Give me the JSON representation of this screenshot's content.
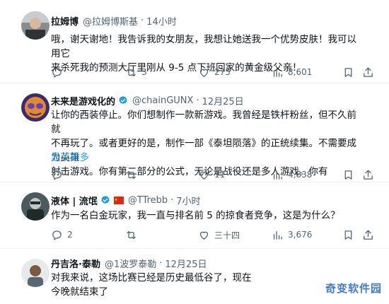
{
  "posts": [
    {
      "name": "拉姆博",
      "handle": "@拉姆博斯基",
      "dot": "·",
      "time": "14小时",
      "lines": [
        "哦，谢天谢地！我告诉我的女朋友，我想让她送我一个优势皮肤！我可以用它",
        "来杀死我的预测大厅里刚从 9-5 点下班回家的黄金级父亲！"
      ],
      "reply_count": "",
      "repost_count": "3",
      "like_count": "275",
      "view_count": "8,601"
    },
    {
      "name": "未来是游戏化的",
      "handle": "@chainGUNX",
      "dot": "·",
      "time": "12月25日",
      "lines": [
        "让你的西装停止。你们想制作一款新游戏。我曾经是铁杆粉丝，但不久前就",
        "不再玩了。或者更好的是，制作一部《泰坦陨落》的正统续集。不需要成为英雄",
        "射击游戏。你有第二部分的公式，无论是战役还是多人游戏。你有"
      ],
      "show_more": "显示更多",
      "reply_count": "",
      "repost_count": "",
      "like_count": "11",
      "view_count": "4,838"
    },
    {
      "name": "液体 | 流氓",
      "handle": "@TTrebb",
      "dot": "·",
      "time": "7小时",
      "lines": [
        "作为一名白金玩家，我一直与排名前 5 的掠食者竞争，这是为什么？"
      ],
      "reply_count": "2",
      "repost_count": "",
      "like_count": "三十四",
      "view_count": "3,676"
    },
    {
      "name": "丹吉洛·泰勒",
      "handle": "@1波罗泰勒",
      "dot": "·",
      "time": "12月25日",
      "lines": [
        "对我来说，这场比赛已经是历史最低谷了，现在",
        "今晚就结束了"
      ]
    }
  ],
  "watermark": "奇变软件园",
  "colors": {
    "text": "#0f1419",
    "muted": "#536471",
    "link": "#1d9bf0",
    "verified": "#1d9bf0",
    "divider": "#eff3f4"
  }
}
